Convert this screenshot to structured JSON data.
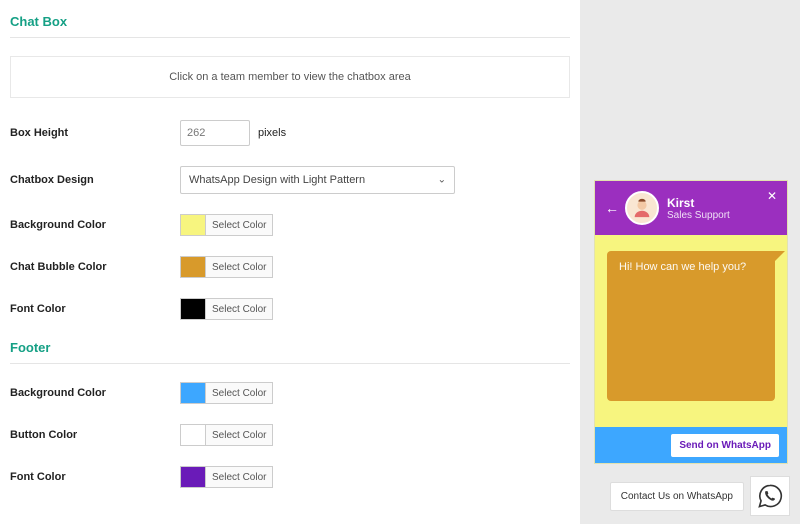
{
  "sections": {
    "chatbox_title": "Chat Box",
    "footer_title": "Footer"
  },
  "notice": "Click on a team member to view the chatbox area",
  "chatbox": {
    "box_height_label": "Box Height",
    "box_height_value": "262",
    "box_height_unit": "pixels",
    "design_label": "Chatbox Design",
    "design_value": "WhatsApp Design with Light Pattern",
    "bg_label": "Background Color",
    "bg_swatch": "#f7f57f",
    "bubble_label": "Chat Bubble Color",
    "bubble_swatch": "#d89a2b",
    "font_label": "Font Color",
    "font_swatch": "#000000",
    "select_color_text": "Select Color"
  },
  "footer": {
    "bg_label": "Background Color",
    "bg_swatch": "#3da7ff",
    "button_label": "Button Color",
    "button_swatch": "#ffffff",
    "font_label": "Font Color",
    "font_swatch": "#6a1bb8"
  },
  "preview": {
    "agent_name": "Kirst",
    "agent_role": "Sales Support",
    "greeting": "Hi! How can we help you?",
    "send_btn": "Send on WhatsApp",
    "contact_btn": "Contact Us on WhatsApp"
  }
}
